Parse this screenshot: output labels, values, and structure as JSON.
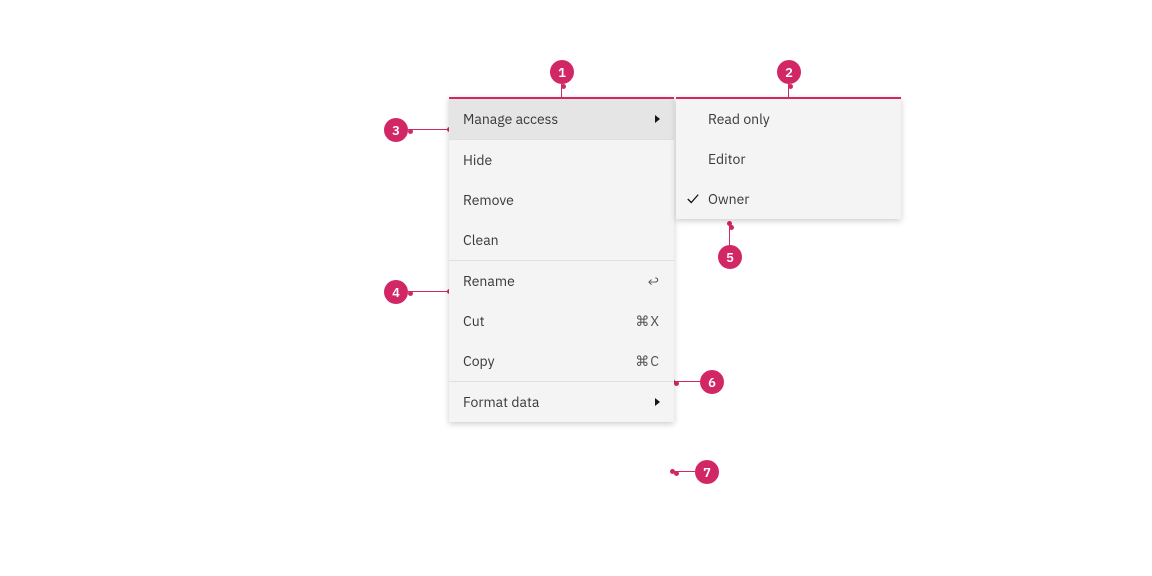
{
  "annotations": {
    "a1": "1",
    "a2": "2",
    "a3": "3",
    "a4": "4",
    "a5": "5",
    "a6": "6",
    "a7": "7"
  },
  "menu1": {
    "manage_access": "Manage access",
    "hide": "Hide",
    "remove": "Remove",
    "clean": "Clean",
    "rename": "Rename",
    "rename_shortcut": "↩",
    "cut": "Cut",
    "cut_shortcut": "⌘X",
    "copy": "Copy",
    "copy_shortcut": "⌘C",
    "format_data": "Format data"
  },
  "menu2": {
    "read_only": "Read only",
    "editor": "Editor",
    "owner": "Owner"
  }
}
